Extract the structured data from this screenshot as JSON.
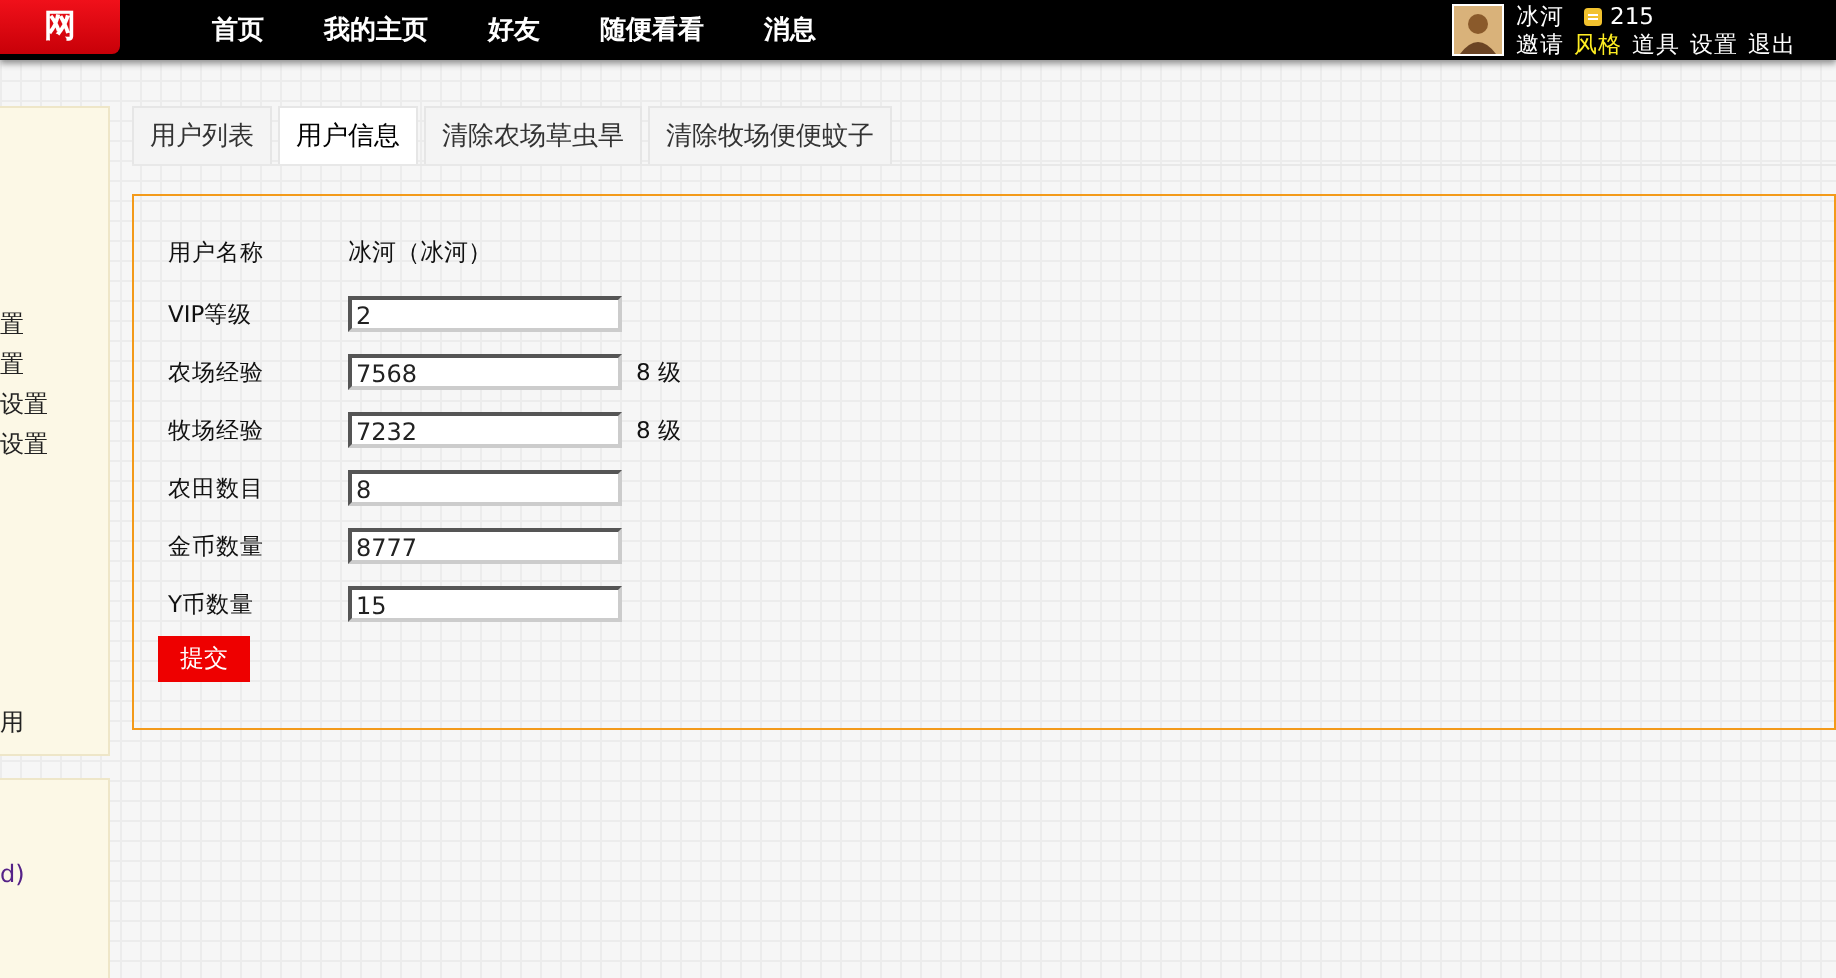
{
  "logo": {
    "text": "网"
  },
  "nav": [
    "首页",
    "我的主页",
    "好友",
    "随便看看",
    "消息"
  ],
  "user": {
    "name": "冰河",
    "coins": "215",
    "links": [
      {
        "label": "邀请",
        "highlighted": false
      },
      {
        "label": "风格",
        "highlighted": true
      },
      {
        "label": "道具",
        "highlighted": false
      },
      {
        "label": "设置",
        "highlighted": false
      },
      {
        "label": "退出",
        "highlighted": false
      }
    ]
  },
  "sidebar": {
    "items": [
      "置",
      "置",
      "设置",
      "设置"
    ],
    "footer_item": "用",
    "panel_2_item": "d)"
  },
  "tabs": [
    {
      "label": "用户列表",
      "selected": false
    },
    {
      "label": "用户信息",
      "selected": true
    },
    {
      "label": "清除农场草虫旱",
      "selected": false
    },
    {
      "label": "清除牧场便便蚊子",
      "selected": false
    }
  ],
  "form": {
    "username_label": "用户名称",
    "username_value": "冰河（冰河）",
    "fields": [
      {
        "label": "VIP等级",
        "value": "2"
      },
      {
        "label": "农场经验",
        "value": "7568",
        "suffix": "8 级"
      },
      {
        "label": "牧场经验",
        "value": "7232",
        "suffix": "8 级"
      },
      {
        "label": "农田数目",
        "value": "8"
      },
      {
        "label": "金币数量",
        "value": "8777"
      },
      {
        "label": "Y币数量",
        "value": "15"
      }
    ],
    "submit": "提交"
  }
}
